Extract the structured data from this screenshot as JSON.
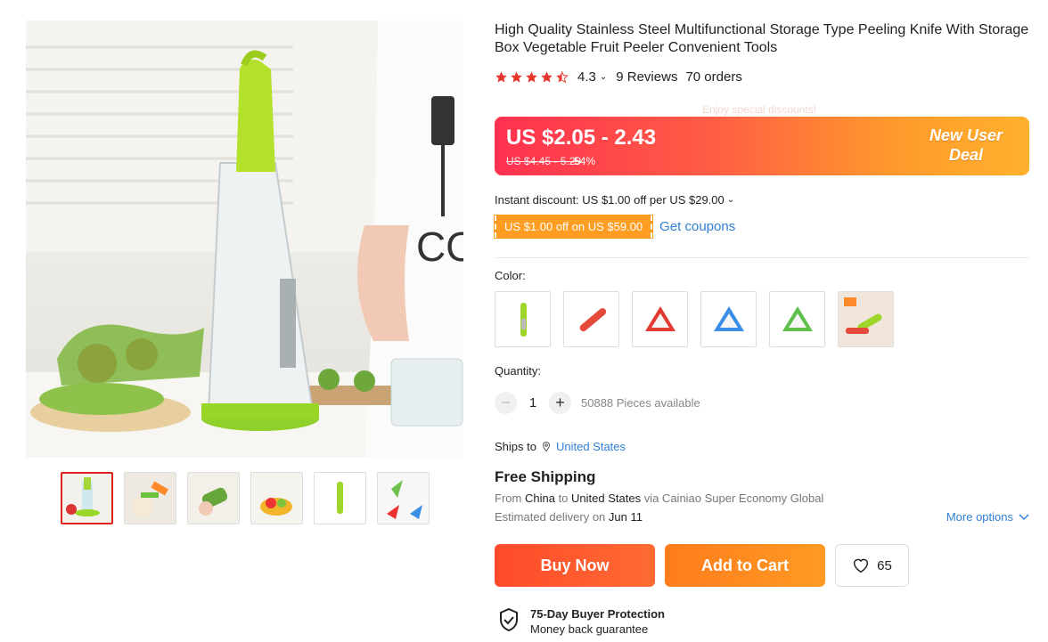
{
  "product": {
    "title": "High Quality Stainless Steel Multifunctional Storage Type Peeling Knife With Storage Box Vegetable Fruit Peeler Convenient Tools",
    "rating": "4.3",
    "reviews": "9 Reviews",
    "orders": "70 orders",
    "stars_filled": 4.3
  },
  "pricing": {
    "promo_hint": "Enjoy special discounts!",
    "current": "US $2.05 - 2.43",
    "original": "US $4.45 - 5.29",
    "discount": "-54%",
    "badge_line1": "New User",
    "badge_line2": "Deal",
    "instant_discount": "Instant discount: US $1.00 off per US $29.00",
    "coupon": "US $1.00 off on US $59.00",
    "get_coupons": "Get coupons"
  },
  "color": {
    "label": "Color:",
    "options": [
      "green peeler",
      "red peeler",
      "red triangle",
      "blue triangle",
      "green triangle",
      "assorted"
    ]
  },
  "quantity": {
    "label": "Quantity:",
    "value": "1",
    "available": "50888 Pieces available"
  },
  "shipping": {
    "ships_to_label": "Ships to",
    "destination": "United States",
    "title": "Free Shipping",
    "from_prefix": "From",
    "from_country": "China",
    "to_word": "to",
    "to_country": "United States",
    "via": "via Cainiao Super Economy Global",
    "est_prefix": "Estimated delivery on",
    "est_date": "Jun 11",
    "more_options": "More options"
  },
  "actions": {
    "buy_now": "Buy Now",
    "add_to_cart": "Add to Cart",
    "wishlist_count": "65"
  },
  "protection": {
    "title": "75-Day Buyer Protection",
    "subtitle": "Money back guarantee"
  },
  "colors": {
    "star": "#e8352b",
    "link": "#2f7fd6",
    "coupon": "#ff9d22",
    "selected_thumb": "#e0241b"
  }
}
